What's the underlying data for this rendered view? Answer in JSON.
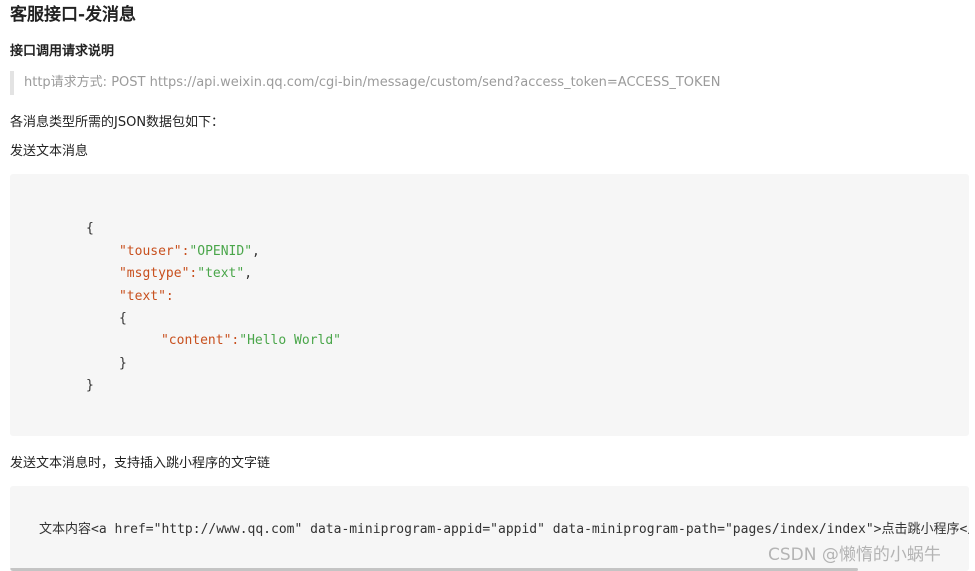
{
  "doc": {
    "title": "客服接口-发消息",
    "subtitle": "接口调用请求说明",
    "request_line": "http请求方式: POST https://api.weixin.qq.com/cgi-bin/message/custom/send?access_token=ACCESS_TOKEN",
    "intro": "各消息类型所需的JSON数据包如下：",
    "text_msg_heading": "发送文本消息",
    "miniprogram_heading": "发送文本消息时，支持插入跳小程序的文字链"
  },
  "code1": {
    "open_brace": "{",
    "touser_key": "\"touser\":",
    "touser_val": "\"OPENID\"",
    "comma1": ",",
    "msgtype_key": "\"msgtype\":",
    "msgtype_val": "\"text\"",
    "comma2": ",",
    "text_key": "\"text\":",
    "inner_open": "{",
    "content_key": "\"content\":",
    "content_val": "\"Hello World\"",
    "inner_close": "}",
    "close_brace": "}"
  },
  "code2": {
    "line": "文本内容<a href=\"http://www.qq.com\" data-miniprogram-appid=\"appid\" data-miniprogram-path=\"pages/index/index\">点击跳小程序</a>"
  },
  "watermark": "CSDN @懒惰的小蜗牛"
}
